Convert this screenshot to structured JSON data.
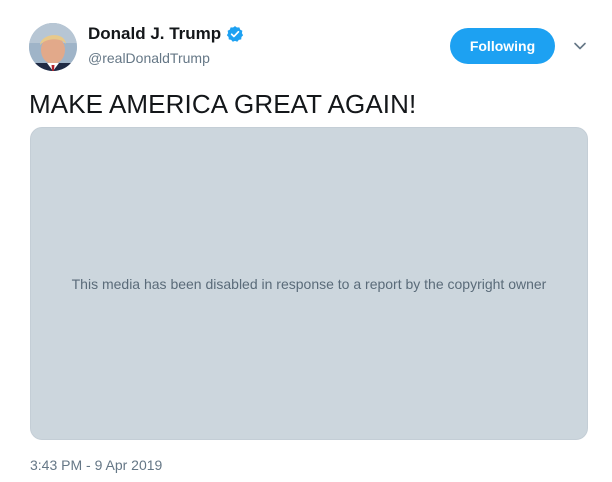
{
  "author": {
    "display_name": "Donald J. Trump",
    "handle": "@realDonaldTrump",
    "verified": true
  },
  "follow_button": {
    "label": "Following"
  },
  "tweet": {
    "text": "MAKE AMERICA GREAT AGAIN!",
    "media_message": "This media has been disabled in response to a report by the copyright owner",
    "timestamp": "3:43 PM - 9 Apr 2019"
  },
  "colors": {
    "accent": "#1da1f2",
    "media_background": "#ccd6dd",
    "secondary_text": "#657786"
  },
  "icons": {
    "verified": "verified-badge-icon",
    "caret": "chevron-down-icon"
  }
}
